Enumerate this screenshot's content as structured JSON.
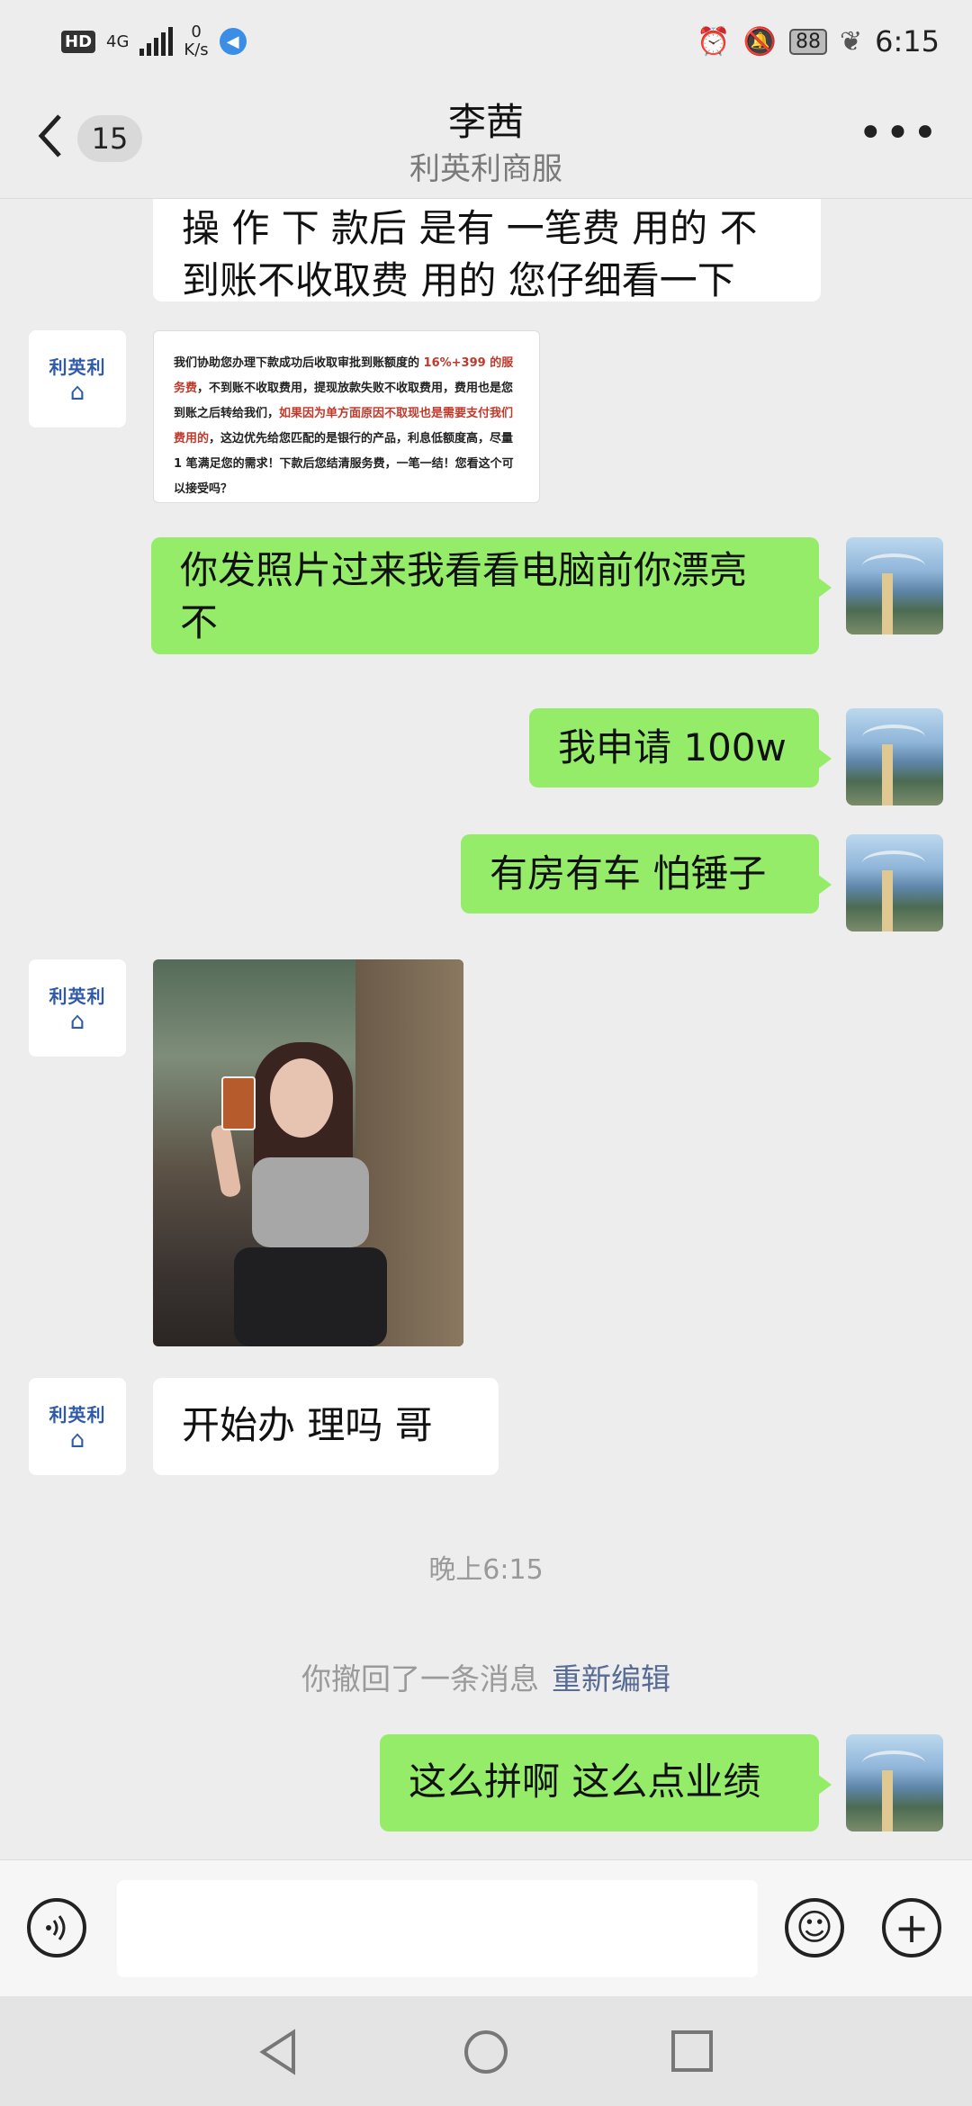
{
  "status": {
    "hd": "HD",
    "network": "4G",
    "speed_value": "0",
    "speed_unit": "K/s",
    "battery": "88",
    "time": "6:15"
  },
  "header": {
    "unread_count": "15",
    "title": "李茜",
    "subtitle": "利英利商服"
  },
  "avatars": {
    "contact_logo_text": "利英利"
  },
  "messages": [
    {
      "side": "in",
      "text_line1": "操 作 下 款后 是有 一笔费 用的 不",
      "text_line2": "到账不收取费 用的 您仔细看一下"
    },
    {
      "side": "in",
      "type": "image-document",
      "doc": {
        "p1a": "我们协助您办理下款成功后收取审批到账额度的 ",
        "p1red": "16%+399 的服务费",
        "p1b": "，不到账不收取费用，提现放款失败不收取费用，费用也是您到账之后转给我们，",
        "p1red2": "如果因为单方面原因不取现也是需要支付我们费用的",
        "p1c": "，这边优先给您匹配的是银行的产品，利息低额度高，尽量 1 笔满足您的需求！下款后您结清服务费，一笔一结！您看这个可以接受吗？"
      }
    },
    {
      "side": "out",
      "text_line1": "你发照片过来我看看电脑前你漂亮",
      "text_line2": "不"
    },
    {
      "side": "out",
      "text": "我申请 100w"
    },
    {
      "side": "out",
      "text": "有房有车 怕锤子"
    },
    {
      "side": "in",
      "type": "image-photo"
    },
    {
      "side": "in",
      "text": "开始办 理吗  哥"
    },
    {
      "side": "out",
      "text": "这么拼啊 这么点业绩"
    }
  ],
  "system": {
    "timestamp": "晚上6:15",
    "recall_text": "你撤回了一条消息",
    "reedit_link": "重新编辑"
  },
  "colors": {
    "outgoing_bubble": "#95ec69",
    "incoming_bubble": "#ffffff",
    "background": "#ededed",
    "link": "#576b95"
  }
}
